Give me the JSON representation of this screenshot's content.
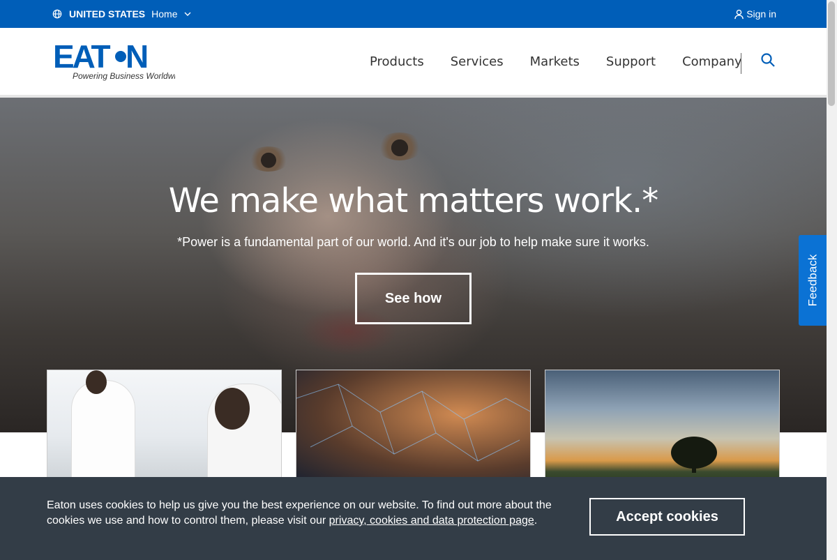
{
  "utility": {
    "country": "UNITED STATES",
    "home": "Home",
    "sign_in": "Sign in"
  },
  "header": {
    "logo_text": "EAT·N",
    "tagline": "Powering Business Worldwide",
    "nav": [
      "Products",
      "Services",
      "Markets",
      "Support",
      "Company"
    ]
  },
  "hero": {
    "title": "We make what matters work.*",
    "subtitle": "*Power is a fundamental part of our world. And it's our job to help make sure it works.",
    "cta": "See how"
  },
  "feedback": {
    "label": "Feedback"
  },
  "cookie": {
    "text_before": "Eaton uses cookies to help us give you the best experience on our website. To find out more about the cookies we use and how to control them, please visit our ",
    "link_text": "privacy, cookies and data protection page",
    "text_after": ".",
    "accept": "Accept cookies"
  },
  "colors": {
    "brand_blue": "#005eb8",
    "cookie_bg": "#333d47",
    "feedback_blue": "#0b72d4"
  },
  "icons": [
    "globe-icon",
    "chevron-down-icon",
    "user-icon",
    "search-icon"
  ]
}
